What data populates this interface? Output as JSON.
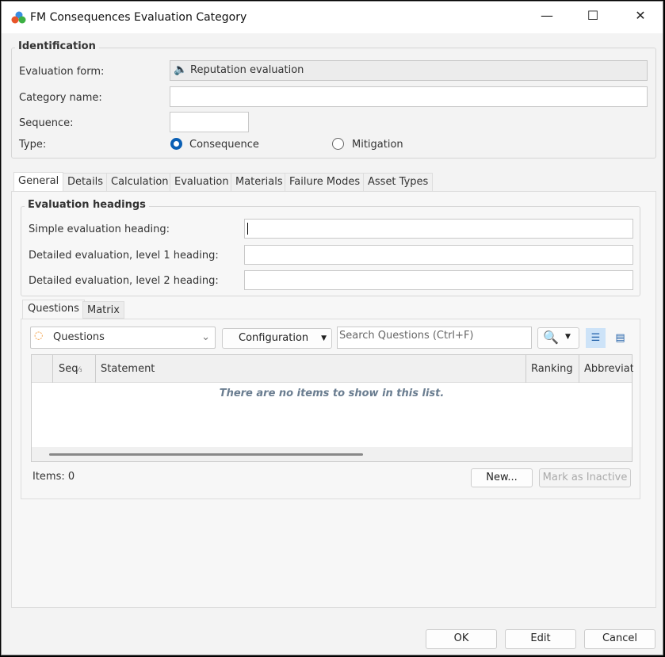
{
  "window": {
    "title": "FM Consequences Evaluation Category",
    "minimize": "—",
    "maximize": "☐",
    "close": "✕"
  },
  "identification": {
    "legend": "Identification",
    "evaluation_form_label": "Evaluation form:",
    "evaluation_form_value": "Reputation evaluation",
    "category_name_label": "Category name:",
    "category_name_value": "",
    "sequence_label": "Sequence:",
    "sequence_value": "",
    "type_label": "Type:",
    "type_options": [
      "Consequence",
      "Mitigation"
    ],
    "type_selected": "Consequence"
  },
  "tabs": [
    "General",
    "Details",
    "Calculation",
    "Evaluation",
    "Materials",
    "Failure Modes",
    "Asset Types"
  ],
  "headings": {
    "legend": "Evaluation headings",
    "simple_label": "Simple evaluation  heading:",
    "level1_label": "Detailed evaluation, level 1 heading:",
    "level2_label": "Detailed evaluation, level 2 heading:"
  },
  "subtabs": [
    "Questions",
    "Matrix"
  ],
  "toolbar": {
    "view_select": "Questions",
    "configuration": "Configuration",
    "search_placeholder": "Search Questions  (Ctrl+F)"
  },
  "table": {
    "columns": [
      "Seq",
      "Statement",
      "Ranking",
      "Abbreviat"
    ],
    "sort_indicator": "⁄₃",
    "empty": "There are no items to show in this list."
  },
  "footer": {
    "items_count": "Items: 0",
    "new_button": "New...",
    "inactive_button": "Mark as Inactive"
  },
  "buttons": {
    "ok": "OK",
    "edit": "Edit",
    "cancel": "Cancel"
  }
}
